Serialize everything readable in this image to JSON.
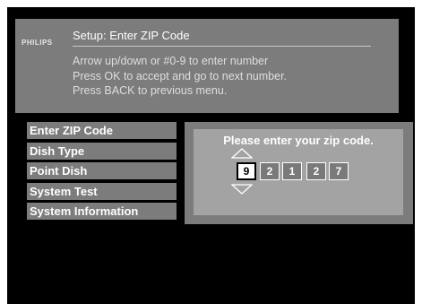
{
  "header": {
    "brand": "PHILIPS",
    "title": "Setup: Enter ZIP Code",
    "instructions": [
      "Arrow up/down or #0-9 to enter number",
      "Press OK to accept and go to next number.",
      "Press BACK to previous menu."
    ]
  },
  "menu": {
    "items": [
      {
        "label": "Enter ZIP Code"
      },
      {
        "label": "Dish Type"
      },
      {
        "label": "Point Dish"
      },
      {
        "label": "System Test"
      },
      {
        "label": "System Information"
      }
    ]
  },
  "zip_entry": {
    "prompt": "Please enter your zip code.",
    "digits": [
      "9",
      "2",
      "1",
      "2",
      "7"
    ],
    "active_index": 0,
    "up_icon": "triangle-up-icon",
    "down_icon": "triangle-down-icon"
  },
  "colors": {
    "screen_background": "#000000",
    "panel": "#7c7c7c",
    "inner_panel": "#a3a3a3",
    "text": "#ffffff"
  }
}
